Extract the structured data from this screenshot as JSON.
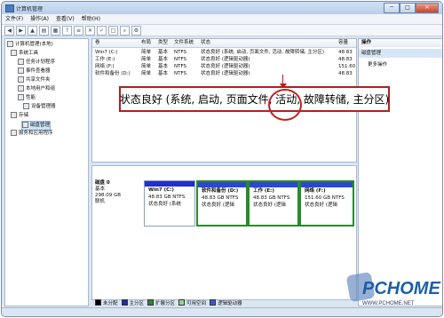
{
  "window": {
    "title": "计算机管理",
    "buttons": [
      "─",
      "□",
      "✕"
    ]
  },
  "menu": [
    "文件(F)",
    "操作(A)",
    "查看(V)",
    "帮助(H)"
  ],
  "tree": [
    {
      "label": "计算机管理(本地)",
      "level": 0
    },
    {
      "label": "系统工具",
      "level": 1
    },
    {
      "label": "任务计划程序",
      "level": 2
    },
    {
      "label": "事件查看器",
      "level": 2
    },
    {
      "label": "共享文件夹",
      "level": 2
    },
    {
      "label": "本地用户和组",
      "level": 2
    },
    {
      "label": "性能",
      "level": 2
    },
    {
      "label": "设备管理器",
      "level": 2
    },
    {
      "label": "存储",
      "level": 1
    },
    {
      "label": "磁盘管理",
      "level": 2
    },
    {
      "label": "服务和应用程序",
      "level": 1
    }
  ],
  "volume_list": {
    "headers": [
      "卷",
      "布局",
      "类型",
      "文件系统",
      "状态",
      "容量"
    ],
    "rows": [
      {
        "vol": "Win7 (C:)",
        "layout": "简单",
        "type": "基本",
        "fs": "NTFS",
        "status": "状态良好 (系统, 启动, 页面文件, 活动, 故障转储, 主分区)",
        "cap": "48.83"
      },
      {
        "vol": "工作 (E:)",
        "layout": "简单",
        "type": "基本",
        "fs": "NTFS",
        "status": "状态良好 (逻辑驱动器)",
        "cap": "48.83"
      },
      {
        "vol": "网络 (F:)",
        "layout": "简单",
        "type": "基本",
        "fs": "NTFS",
        "status": "状态良好 (逻辑驱动器)",
        "cap": "151.60"
      },
      {
        "vol": "软件和备份 (D:)",
        "layout": "简单",
        "type": "基本",
        "fs": "NTFS",
        "status": "状态良好 (逻辑驱动器)",
        "cap": "48.83"
      }
    ]
  },
  "callout": "状态良好 (系统, 启动, 页面文件, 活动, 故障转储, 主分区)",
  "actions": {
    "header": "操作",
    "section": "磁盘管理",
    "item": "更多操作"
  },
  "disk": {
    "name": "磁盘 0",
    "type": "基本",
    "size": "298.09 GB",
    "state": "联机",
    "partitions": [
      {
        "name": "Win7 (C:)",
        "size": "48.83 GB NTFS",
        "status": "状态良好 (系统"
      },
      {
        "name": "软件和备份 (D:)",
        "size": "48.83 GB NTFS",
        "status": "状态良好 (逻辑"
      },
      {
        "name": "工作 (E:)",
        "size": "48.83 GB NTFS",
        "status": "状态良好 (逻辑"
      },
      {
        "name": "网络 (F:)",
        "size": "151.60 GB NTFS",
        "status": "状态良好 (逻辑"
      }
    ]
  },
  "legend": [
    {
      "label": "未分配",
      "color": "#000000"
    },
    {
      "label": "主分区",
      "color": "#1a2ea8"
    },
    {
      "label": "扩展分区",
      "color": "#2f8a2f"
    },
    {
      "label": "可用空间",
      "color": "#8fd88f"
    },
    {
      "label": "逻辑驱动器",
      "color": "#3a56d6"
    }
  ],
  "watermark": {
    "brand": "PCHOME",
    "url": "WWW.PCHOME.NET"
  }
}
